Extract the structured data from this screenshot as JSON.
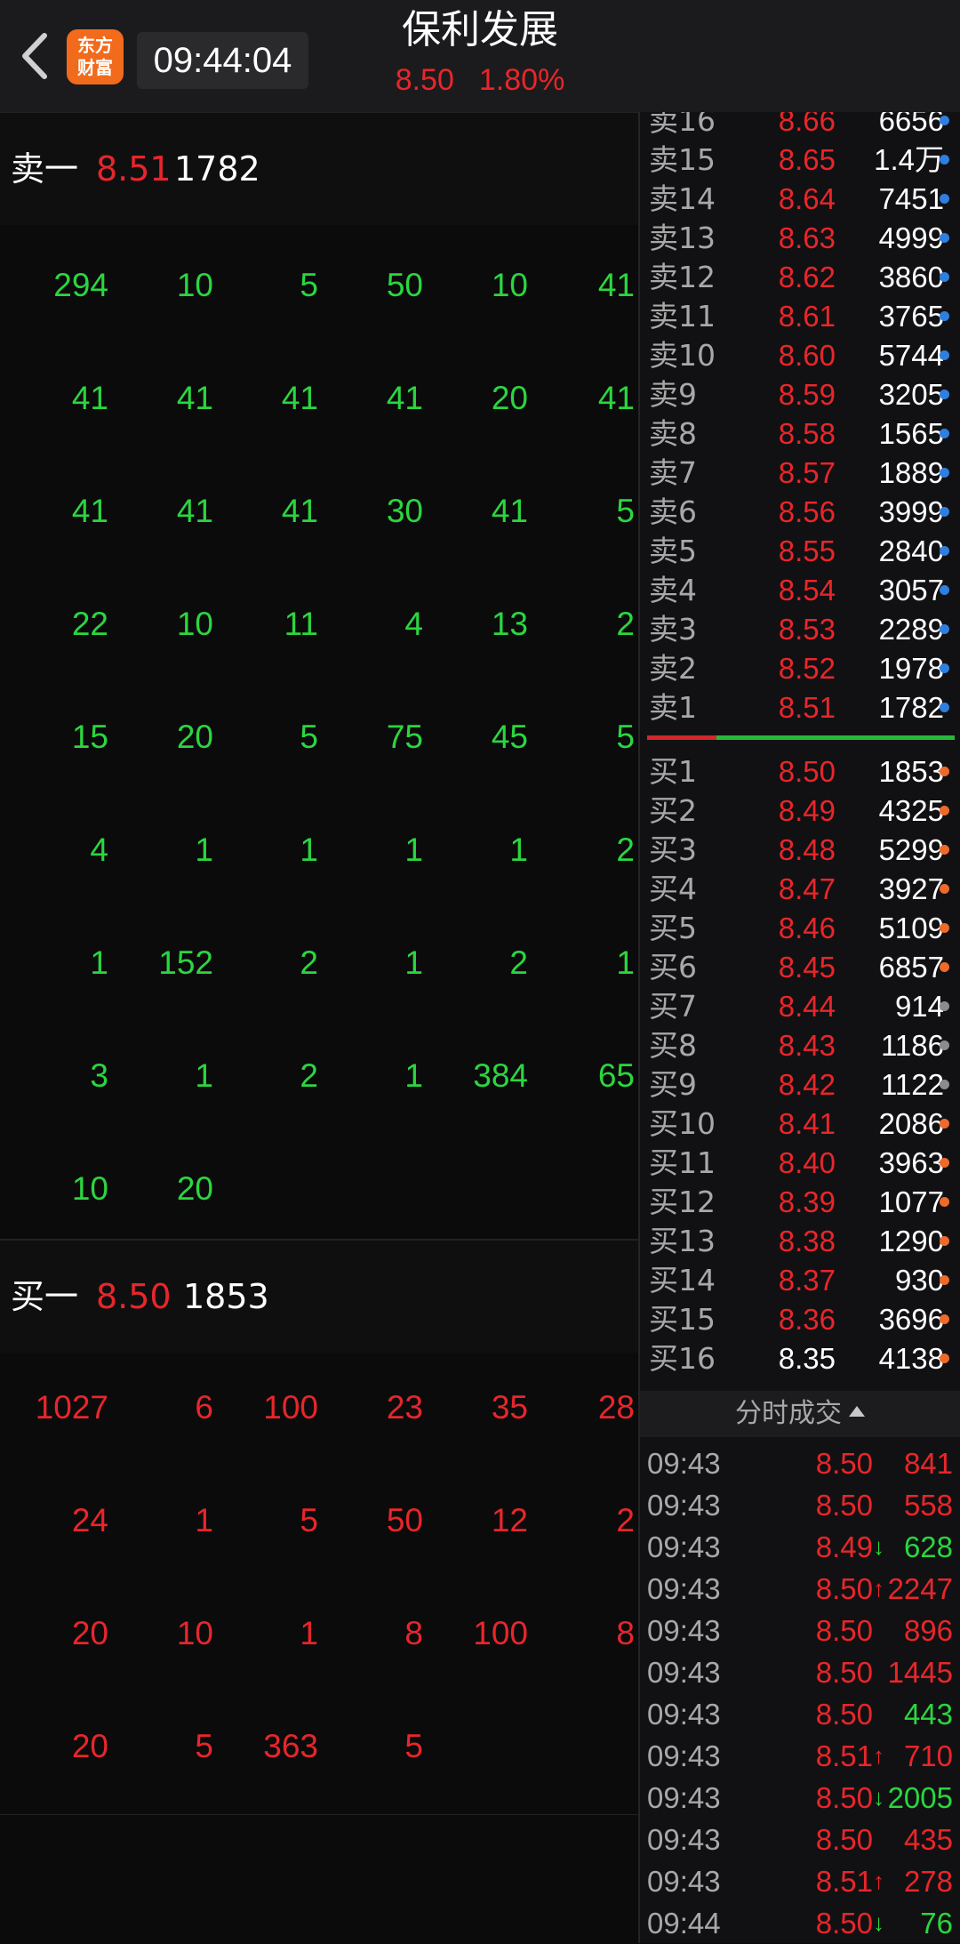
{
  "header": {
    "clock": "09:44:04",
    "logo_line1": "东方",
    "logo_line2": "财富",
    "stock_name": "保利发展",
    "price": "8.50",
    "change_pct": "1.80%"
  },
  "colors": {
    "up": "#e8262a",
    "down": "#2bd63f",
    "neutral": "#ffffff",
    "dot_blue": "#2f7fe0",
    "dot_orange": "#ee6a2a",
    "dot_gray": "#8c8c8c"
  },
  "sell_head": {
    "label": "卖一",
    "price": "8.51",
    "volume": "1782"
  },
  "sell_queue": [
    [
      "294",
      "10",
      "5",
      "50",
      "10",
      "41"
    ],
    [
      "41",
      "41",
      "41",
      "41",
      "20",
      "41"
    ],
    [
      "41",
      "41",
      "41",
      "30",
      "41",
      "5"
    ],
    [
      "22",
      "10",
      "11",
      "4",
      "13",
      "2"
    ],
    [
      "15",
      "20",
      "5",
      "75",
      "45",
      "5"
    ],
    [
      "4",
      "1",
      "1",
      "1",
      "1",
      "2"
    ],
    [
      "1",
      "152",
      "2",
      "1",
      "2",
      "1"
    ],
    [
      "3",
      "1",
      "2",
      "1",
      "384",
      "65"
    ],
    [
      "10",
      "20"
    ]
  ],
  "buy_head": {
    "label": "买一",
    "price": "8.50",
    "volume": "1853"
  },
  "buy_queue": [
    [
      "1027",
      "6",
      "100",
      "23",
      "35",
      "28"
    ],
    [
      "24",
      "1",
      "5",
      "50",
      "12",
      "2"
    ],
    [
      "20",
      "10",
      "1",
      "8",
      "100",
      "8"
    ],
    [
      "20",
      "5",
      "363",
      "5"
    ]
  ],
  "asks": [
    {
      "label": "卖16",
      "price": "8.66",
      "volume": "6656",
      "dot": "blue"
    },
    {
      "label": "卖15",
      "price": "8.65",
      "volume": "1.4万",
      "dot": "blue"
    },
    {
      "label": "卖14",
      "price": "8.64",
      "volume": "7451",
      "dot": "blue"
    },
    {
      "label": "卖13",
      "price": "8.63",
      "volume": "4999",
      "dot": "blue"
    },
    {
      "label": "卖12",
      "price": "8.62",
      "volume": "3860",
      "dot": "blue"
    },
    {
      "label": "卖11",
      "price": "8.61",
      "volume": "3765",
      "dot": "blue"
    },
    {
      "label": "卖10",
      "price": "8.60",
      "volume": "5744",
      "dot": "blue"
    },
    {
      "label": "卖9",
      "price": "8.59",
      "volume": "3205",
      "dot": "blue"
    },
    {
      "label": "卖8",
      "price": "8.58",
      "volume": "1565",
      "dot": "blue"
    },
    {
      "label": "卖7",
      "price": "8.57",
      "volume": "1889",
      "dot": "blue"
    },
    {
      "label": "卖6",
      "price": "8.56",
      "volume": "3999",
      "dot": "blue"
    },
    {
      "label": "卖5",
      "price": "8.55",
      "volume": "2840",
      "dot": "blue"
    },
    {
      "label": "卖4",
      "price": "8.54",
      "volume": "3057",
      "dot": "blue"
    },
    {
      "label": "卖3",
      "price": "8.53",
      "volume": "2289",
      "dot": "blue"
    },
    {
      "label": "卖2",
      "price": "8.52",
      "volume": "1978",
      "dot": "blue"
    },
    {
      "label": "卖1",
      "price": "8.51",
      "volume": "1782",
      "dot": "blue"
    }
  ],
  "bids": [
    {
      "label": "买1",
      "price": "8.50",
      "volume": "1853",
      "dot": "orange",
      "color": "red"
    },
    {
      "label": "买2",
      "price": "8.49",
      "volume": "4325",
      "dot": "orange",
      "color": "red"
    },
    {
      "label": "买3",
      "price": "8.48",
      "volume": "5299",
      "dot": "orange",
      "color": "red"
    },
    {
      "label": "买4",
      "price": "8.47",
      "volume": "3927",
      "dot": "orange",
      "color": "red"
    },
    {
      "label": "买5",
      "price": "8.46",
      "volume": "5109",
      "dot": "orange",
      "color": "red"
    },
    {
      "label": "买6",
      "price": "8.45",
      "volume": "6857",
      "dot": "orange",
      "color": "red"
    },
    {
      "label": "买7",
      "price": "8.44",
      "volume": "914",
      "dot": "gray",
      "color": "red"
    },
    {
      "label": "买8",
      "price": "8.43",
      "volume": "1186",
      "dot": "gray",
      "color": "red"
    },
    {
      "label": "买9",
      "price": "8.42",
      "volume": "1122",
      "dot": "gray",
      "color": "red"
    },
    {
      "label": "买10",
      "price": "8.41",
      "volume": "2086",
      "dot": "orange",
      "color": "red"
    },
    {
      "label": "买11",
      "price": "8.40",
      "volume": "3963",
      "dot": "orange",
      "color": "red"
    },
    {
      "label": "买12",
      "price": "8.39",
      "volume": "1077",
      "dot": "orange",
      "color": "red"
    },
    {
      "label": "买13",
      "price": "8.38",
      "volume": "1290",
      "dot": "orange",
      "color": "red"
    },
    {
      "label": "买14",
      "price": "8.37",
      "volume": "930",
      "dot": "orange",
      "color": "red"
    },
    {
      "label": "买15",
      "price": "8.36",
      "volume": "3696",
      "dot": "orange",
      "color": "red"
    },
    {
      "label": "买16",
      "price": "8.35",
      "volume": "4138",
      "dot": "orange",
      "color": "white"
    }
  ],
  "trades_title": "分时成交",
  "trades": [
    {
      "time": "09:43",
      "price": "8.50",
      "arrow": "",
      "volume": "841",
      "vol_color": "red"
    },
    {
      "time": "09:43",
      "price": "8.50",
      "arrow": "",
      "volume": "558",
      "vol_color": "red"
    },
    {
      "time": "09:43",
      "price": "8.49",
      "arrow": "↓",
      "volume": "628",
      "vol_color": "green"
    },
    {
      "time": "09:43",
      "price": "8.50",
      "arrow": "↑",
      "volume": "2247",
      "vol_color": "red"
    },
    {
      "time": "09:43",
      "price": "8.50",
      "arrow": "",
      "volume": "896",
      "vol_color": "red"
    },
    {
      "time": "09:43",
      "price": "8.50",
      "arrow": "",
      "volume": "1445",
      "vol_color": "red"
    },
    {
      "time": "09:43",
      "price": "8.50",
      "arrow": "",
      "volume": "443",
      "vol_color": "green"
    },
    {
      "time": "09:43",
      "price": "8.51",
      "arrow": "↑",
      "volume": "710",
      "vol_color": "red"
    },
    {
      "time": "09:43",
      "price": "8.50",
      "arrow": "↓",
      "volume": "2005",
      "vol_color": "green"
    },
    {
      "time": "09:43",
      "price": "8.50",
      "arrow": "",
      "volume": "435",
      "vol_color": "red"
    },
    {
      "time": "09:43",
      "price": "8.51",
      "arrow": "↑",
      "volume": "278",
      "vol_color": "red"
    },
    {
      "time": "09:44",
      "price": "8.50",
      "arrow": "↓",
      "volume": "76",
      "vol_color": "green"
    }
  ]
}
